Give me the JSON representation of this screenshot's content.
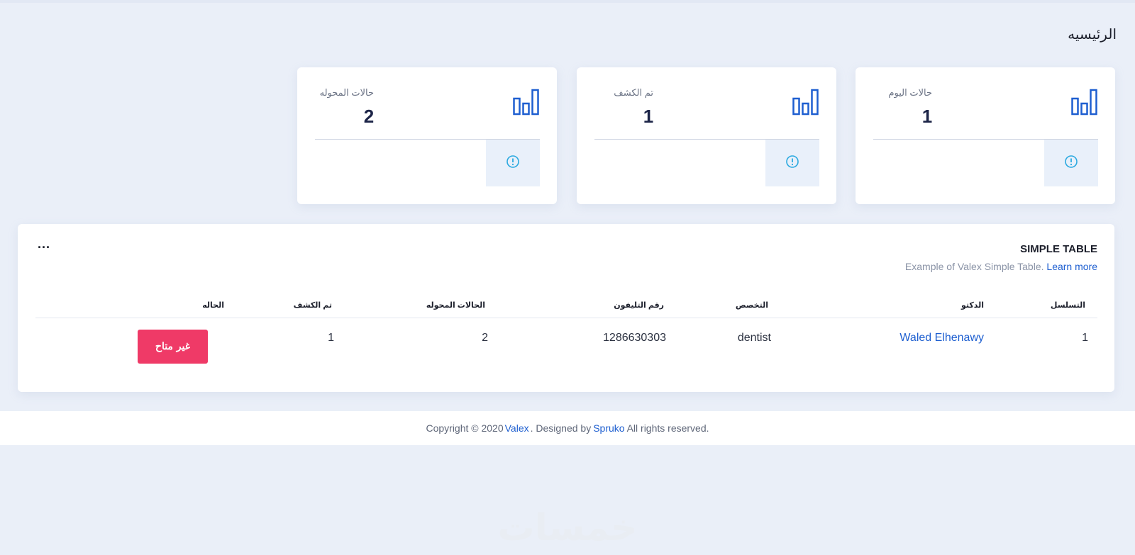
{
  "page": {
    "title": "الرئيسيه"
  },
  "stats": [
    {
      "label": "حالات اليوم",
      "value": "1",
      "icon": "bar-chart-icon",
      "info_icon": "info-circle-icon"
    },
    {
      "label": "تم الكشف",
      "value": "1",
      "icon": "bar-chart-icon",
      "info_icon": "info-circle-icon"
    },
    {
      "label": "حالات المحوله",
      "value": "2",
      "icon": "bar-chart-icon",
      "info_icon": "info-circle-icon"
    }
  ],
  "table": {
    "title": "SIMPLE TABLE",
    "subtitle": "Example of Valex Simple Table.",
    "learn_more": "Learn more",
    "more_label": "...",
    "headers": {
      "serial": "التسلسل",
      "doctor": "الدكتو",
      "specialty": "التخصص",
      "phone": "رقم التليفون",
      "transferred": "الحالات المحوله",
      "examined": "تم الكشف",
      "status": "الحاله"
    },
    "rows": [
      {
        "serial": "1",
        "doctor": "Waled Elhenawy",
        "specialty": "dentist",
        "phone": "1286630303",
        "transferred": "2",
        "examined": "1",
        "status": "غير متاح"
      }
    ]
  },
  "footer": {
    "prefix": "Copyright © 2020 ",
    "brand": "Valex",
    "middle": ". Designed by ",
    "designer": "Spruko",
    "suffix": " All rights reserved."
  },
  "watermark": {
    "text": "خمسات"
  },
  "colors": {
    "accent": "#1e5fd0",
    "danger": "#ef3a67",
    "background": "#eaeff8",
    "info": "#2aa9e0"
  }
}
